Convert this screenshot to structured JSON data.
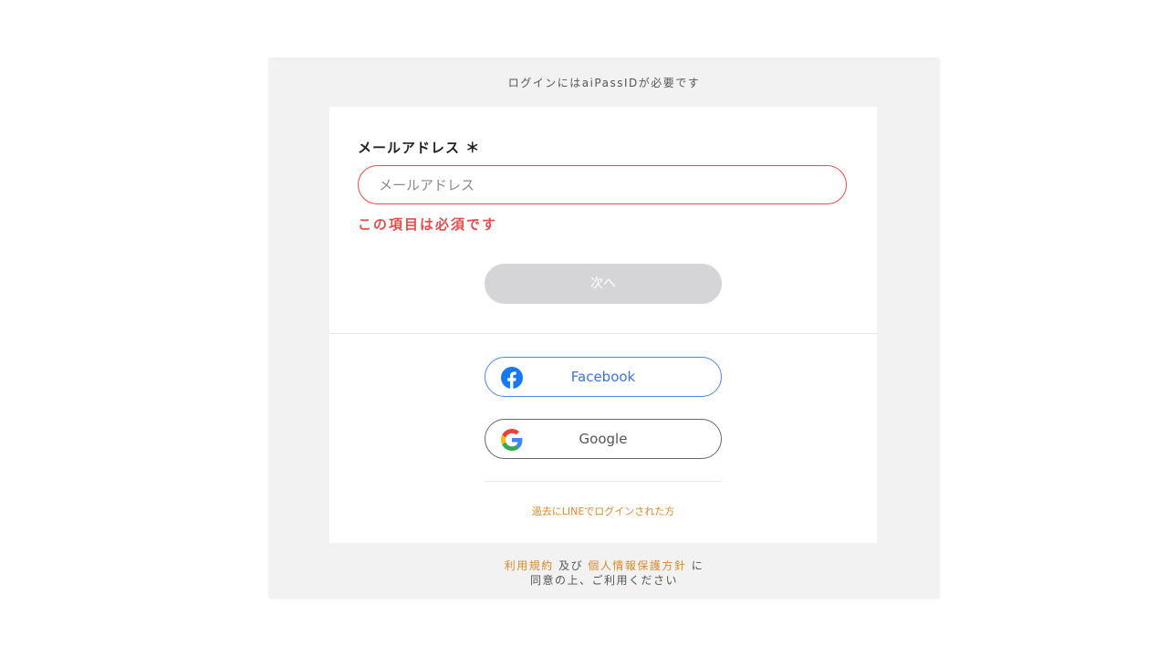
{
  "notice": "ログインにはaiPassIDが必要です",
  "form": {
    "email_label": "メールアドレス ＊",
    "email_value": "",
    "email_placeholder": "メールアドレス",
    "error_message": "この項目は必須です",
    "next_label": "次へ"
  },
  "social": {
    "facebook_label": "Facebook",
    "google_label": "Google"
  },
  "line_link": "過去にLINEでログインされた方",
  "terms": {
    "terms_link": "利用規約",
    "and": " 及び ",
    "privacy_link": "個人情報保護方針",
    "particle": " に",
    "line2": "同意の上、ご利用ください"
  },
  "colors": {
    "error": "#e44d4d",
    "link": "#d9892b",
    "facebook": "#1877f2",
    "disabled_button": "#d5d5d8"
  }
}
